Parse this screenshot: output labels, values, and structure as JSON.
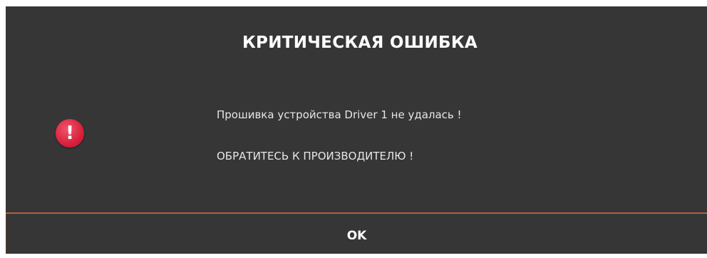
{
  "dialog": {
    "title": "КРИТИЧЕСКАЯ ОШИБКА",
    "icon": "error-exclamation-icon",
    "icon_glyph": "!",
    "message_line1": "Прошивка устройства Driver 1 не удалась !",
    "message_line2": "ОБРАТИТЕСЬ К ПРОИЗВОДИТЕЛЮ !",
    "ok_label": "OK"
  },
  "colors": {
    "background": "#363636",
    "accent_divider": "#b0603e",
    "error_icon": "#d8213d",
    "text": "#ffffff"
  }
}
